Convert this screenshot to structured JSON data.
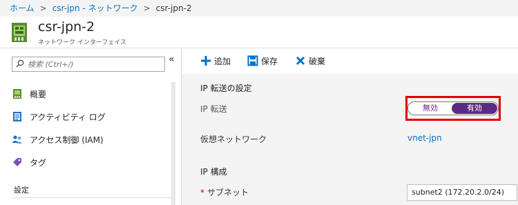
{
  "breadcrumb": {
    "items": [
      "ホーム",
      "csr-jpn - ネットワーク",
      "csr-jpn-2"
    ],
    "separator": ">"
  },
  "resource": {
    "title": "csr-jpn-2",
    "subtitle": "ネットワーク インターフェイス",
    "icon": "network-interface-icon"
  },
  "sidebar": {
    "collapse_glyph": "«",
    "search_placeholder": "検索 (Ctrl+/)",
    "items": [
      {
        "label": "概要",
        "icon": "overview-icon"
      },
      {
        "label": "アクティビティ ログ",
        "icon": "activity-log-icon"
      },
      {
        "label": "アクセス制御 (IAM)",
        "icon": "iam-icon"
      },
      {
        "label": "タグ",
        "icon": "tag-icon"
      }
    ],
    "section_label": "設定"
  },
  "toolbar": {
    "add_label": "追加",
    "save_label": "保存",
    "discard_label": "破棄"
  },
  "ip_forwarding": {
    "section_title": "IP 転送の設定",
    "field_label": "IP 転送",
    "toggle_off_label": "無効",
    "toggle_on_label": "有効",
    "selected": "有効"
  },
  "virtual_network": {
    "label": "仮想ネットワーク",
    "value": "vnet-jpn"
  },
  "ip_config": {
    "section_title": "IP 構成",
    "subnet_label": "サブネット",
    "required_marker": "*",
    "subnet_value": "subnet2 (172.20.2.0/24)"
  },
  "colors": {
    "link": "#0072c6",
    "toggle_selected": "#5b2a86",
    "highlight_border": "#e30000",
    "toolbar_icon": "#0072c6"
  }
}
